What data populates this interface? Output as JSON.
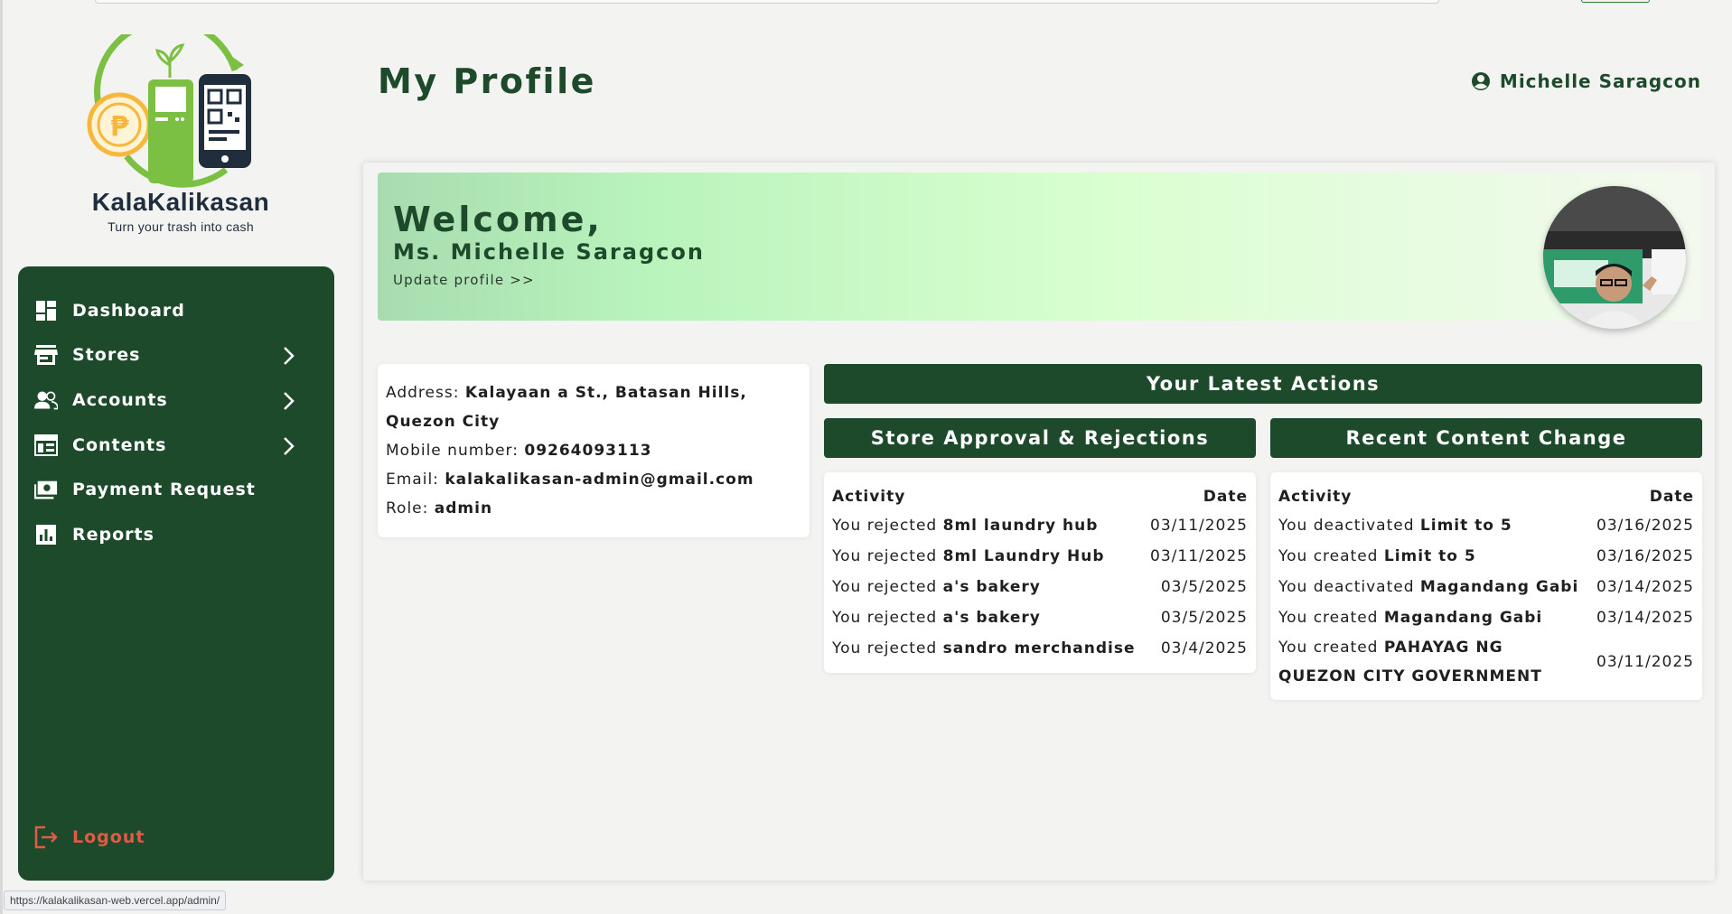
{
  "brand": {
    "name": "KalaKalikasan",
    "tagline": "Turn your trash into cash"
  },
  "sidebar": {
    "items": [
      {
        "label": "Dashboard",
        "icon": "dashboard-icon",
        "has_chevron": false
      },
      {
        "label": "Stores",
        "icon": "store-icon",
        "has_chevron": true
      },
      {
        "label": "Accounts",
        "icon": "people-icon",
        "has_chevron": true
      },
      {
        "label": "Contents",
        "icon": "contents-icon",
        "has_chevron": true
      },
      {
        "label": "Payment Request",
        "icon": "payment-icon",
        "has_chevron": false
      },
      {
        "label": "Reports",
        "icon": "reports-icon",
        "has_chevron": false
      }
    ],
    "logout_label": "Logout"
  },
  "header": {
    "title": "My Profile",
    "user_name": "Michelle Saragcon"
  },
  "welcome": {
    "greeting": "Welcome,",
    "name": "Ms. Michelle Saragcon",
    "update_link": "Update profile >>"
  },
  "profile": {
    "address_label": "Address:",
    "address_value": "Kalayaan a St., Batasan Hills, Quezon City",
    "mobile_label": "Mobile number:",
    "mobile_value": "09264093113",
    "email_label": "Email:",
    "email_value": "kalakalikasan-admin@gmail.com",
    "role_label": "Role:",
    "role_value": "admin"
  },
  "latest_actions_title": "Your Latest Actions",
  "store_table": {
    "title": "Store Approval & Rejections",
    "col_activity": "Activity",
    "col_date": "Date",
    "rows": [
      {
        "prefix": "You rejected",
        "subject": "8ml laundry hub",
        "date": "03/11/2025"
      },
      {
        "prefix": "You rejected",
        "subject": "8ml Laundry Hub",
        "date": "03/11/2025"
      },
      {
        "prefix": "You rejected",
        "subject": "a's bakery",
        "date": "03/5/2025"
      },
      {
        "prefix": "You rejected",
        "subject": "a's bakery",
        "date": "03/5/2025"
      },
      {
        "prefix": "You rejected",
        "subject": "sandro merchandise",
        "date": "03/4/2025"
      }
    ]
  },
  "content_table": {
    "title": "Recent Content Change",
    "col_activity": "Activity",
    "col_date": "Date",
    "rows": [
      {
        "prefix": "You deactivated",
        "subject": "Limit to 5",
        "date": "03/16/2025"
      },
      {
        "prefix": "You created",
        "subject": "Limit to 5",
        "date": "03/16/2025"
      },
      {
        "prefix": "You deactivated",
        "subject": "Magandang Gabi",
        "date": "03/14/2025"
      },
      {
        "prefix": "You created",
        "subject": "Magandang Gabi",
        "date": "03/14/2025"
      },
      {
        "prefix": "You created",
        "subject": "PAHAYAG NG QUEZON CITY GOVERNMENT",
        "date": "03/11/2025"
      }
    ]
  },
  "status_bar_url": "https://kalakalikasan-web.vercel.app/admin/",
  "colors": {
    "primary": "#1e4a2c",
    "logout": "#e35a45",
    "logo_green": "#7cc043",
    "coin": "#f6b73c"
  }
}
